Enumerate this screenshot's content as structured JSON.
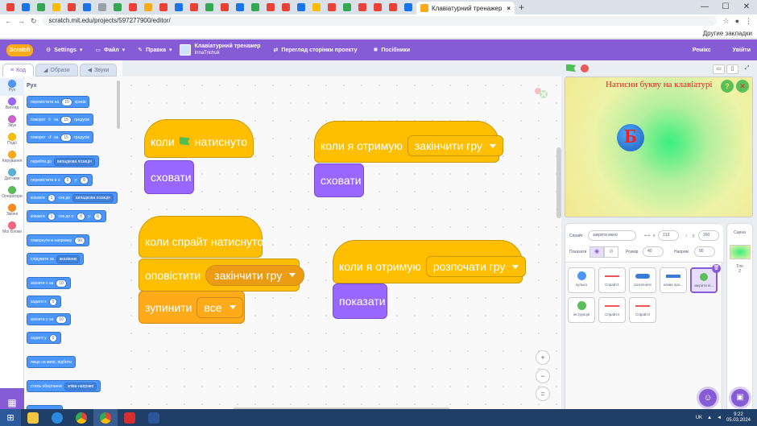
{
  "browser": {
    "active_tab_title": "Клавіатурний тренажер on Scratch",
    "url": "scratch.mit.edu/projects/597277900/editor/",
    "bookmarks_other": "Другие закладки",
    "tab_colors": [
      "#ea4335",
      "#1a73e8",
      "#34a853",
      "#fbbc05",
      "#ea4335",
      "#1a73e8",
      "#9aa0a6",
      "#34a853",
      "#ea4335",
      "#ffab19",
      "#ea4335",
      "#1a73e8",
      "#ea4335",
      "#34a853",
      "#ea4335",
      "#1a73e8",
      "#34a853",
      "#ea4335",
      "#ea4335",
      "#1a73e8",
      "#fbbc05",
      "#ea4335",
      "#34a853",
      "#ea4335",
      "#ea4335",
      "#ea4335",
      "#1a73e8"
    ]
  },
  "menubar": {
    "logo": "Scratch",
    "settings": "Settings",
    "file": "Файл",
    "edit": "Правка",
    "project_title": "Клавіатурний тренажер",
    "project_author": "InnaTrichuk",
    "see_project_page": "Перегляд сторінки проекту",
    "tutorials": "Посібники",
    "remix": "Ремікс",
    "signin": "Увійти",
    "colors": {
      "bar": "#855cd6"
    }
  },
  "editor_tabs": [
    "Код",
    "Образи",
    "Звуки"
  ],
  "categories": [
    {
      "label": "Рух",
      "color": "#4c97ff"
    },
    {
      "label": "Вигляд",
      "color": "#9966ff"
    },
    {
      "label": "Звук",
      "color": "#cf63cf"
    },
    {
      "label": "Події",
      "color": "#ffbf00"
    },
    {
      "label": "Керування",
      "color": "#ffab19"
    },
    {
      "label": "Датчики",
      "color": "#5cb1d6"
    },
    {
      "label": "Оператори",
      "color": "#59c059"
    },
    {
      "label": "Змінні",
      "color": "#ff8c1a"
    },
    {
      "label": "Мої Блоки",
      "color": "#ff6680"
    }
  ],
  "palette": {
    "heading": "Рух",
    "move": {
      "text": "перемістити на",
      "val": "10",
      "tail": "кроків"
    },
    "turn_right": {
      "text": "поворот",
      "on": "на",
      "val": "15",
      "tail": "градусів"
    },
    "turn_left": {
      "text": "поворот",
      "on": "на",
      "val": "15",
      "tail": "градусів"
    },
    "goto": {
      "text": "перейти до",
      "dd": "випадкова позиція"
    },
    "gotoxy": {
      "text": "перемістити в x:",
      "x": "0",
      "y": "y:",
      "yv": "0"
    },
    "glide_to": {
      "text": "ковзати",
      "val": "1",
      "mid": "сек до",
      "dd": "випадкова позиція"
    },
    "glide_xy": {
      "text": "ковзати",
      "val": "1",
      "mid": "сек до x:",
      "x": "0",
      "y": "y:",
      "yv": "0"
    },
    "point_dir": {
      "text": "повернути в напрямку",
      "val": "90"
    },
    "point_to": {
      "text": "слідувати за",
      "dd": "вказівник"
    },
    "change_x": {
      "text": "змінити x на",
      "val": "10"
    },
    "set_x": {
      "text": "задати x",
      "val": "0"
    },
    "change_y": {
      "text": "змінити у на",
      "val": "10"
    },
    "set_y": {
      "text": "задати у",
      "val": "0"
    },
    "bounce": {
      "text": "якщо на межі, відбити"
    },
    "rotation": {
      "text": "стиль обертання",
      "dd": "зліва-направо"
    }
  },
  "scripts": {
    "s1_hat": {
      "pre": "коли",
      "post": "натиснуто"
    },
    "s1_hide": "сховати",
    "s2_hat": "коли я отримую",
    "s2_msg": "закінчити гру",
    "s2_hide": "сховати",
    "s3_hat": "коли спрайт натиснуто",
    "s3_broadcast": "оповістити",
    "s3_msg": "закінчити гру",
    "s3_stop": "зупинити",
    "s3_stop_opt": "все",
    "s4_hat": "коли я отримую",
    "s4_msg": "розпочати гру",
    "s4_show": "показати"
  },
  "zoom": {
    "in": "+",
    "out": "−",
    "reset": "="
  },
  "stage": {
    "text": "Натисни букву на клавіатурі",
    "letter": "Б"
  },
  "sprite_info": {
    "sprite_label": "Спрайт",
    "sprite_name": "закрити вікно",
    "x_label": "x",
    "x": "213",
    "y_label": "y",
    "y": "160",
    "show_label": "Показати",
    "size_label": "Розмір",
    "size": "40",
    "dir_label": "Напрям",
    "dir": "90"
  },
  "sprites": [
    {
      "name": "кулька",
      "color": "#4c97ff"
    },
    {
      "name": "Спрайт1",
      "color": "#e55"
    },
    {
      "name": "розпочати",
      "color": "#3a7bd5"
    },
    {
      "name": "назва про...",
      "color": "#3a7bd5"
    },
    {
      "name": "закрити ві...",
      "color": "#59c059",
      "selected": true
    },
    {
      "name": "інструкція",
      "color": "#59c059"
    },
    {
      "name": "Спрайт3",
      "color": "#e55"
    },
    {
      "name": "Спрайт4",
      "color": "#e55"
    }
  ],
  "stage_pane": {
    "label": "Сцена",
    "backdrops_label": "Тло",
    "backdrops": "2"
  },
  "taskbar": {
    "lang": "UK",
    "time": "9:22",
    "date": "05.03.2024"
  }
}
